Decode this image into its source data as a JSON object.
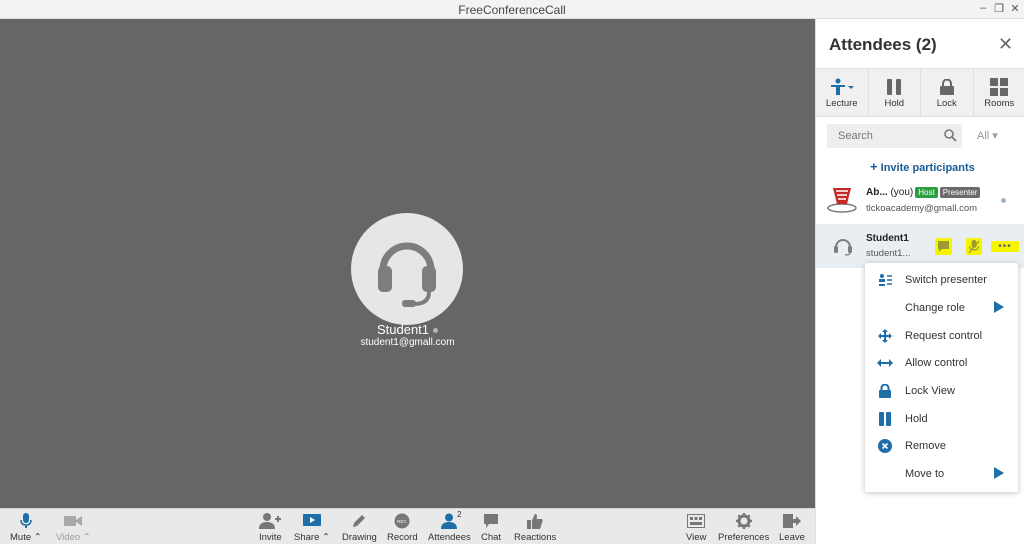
{
  "window": {
    "title": "FreeConferenceCall"
  },
  "stage": {
    "participant_name": "Student1",
    "participant_email": "student1@gmall.com"
  },
  "toolbar": {
    "mute": "Mute",
    "video": "Video",
    "invite": "Invite",
    "share": "Share",
    "drawing": "Drawing",
    "record": "Record",
    "attendees": "Attendees",
    "attendees_count": "2",
    "chat": "Chat",
    "reactions": "Reactions",
    "view": "View",
    "preferences": "Preferences",
    "leave": "Leave",
    "record_icon_text": "REC"
  },
  "panel": {
    "title": "Attendees (2)",
    "tools": {
      "lecture": "Lecture",
      "hold": "Hold",
      "lock": "Lock",
      "rooms": "Rooms"
    },
    "search_placeholder": "Search",
    "filter": "All",
    "invite_label": "Invite participants",
    "attendees": [
      {
        "name": "Ab...",
        "you": "(you)",
        "tag_host": "Host",
        "tag_presenter": "Presenter",
        "email": "tlckoacademy@gmall.com"
      },
      {
        "name": "Student1",
        "email": "student1..."
      }
    ]
  },
  "menu": {
    "items": [
      "Switch presenter",
      "Change role",
      "Request control",
      "Allow control",
      "Lock View",
      "Hold",
      "Remove",
      "Move to"
    ]
  },
  "colors": {
    "accent": "#1e6ea7",
    "host": "#2b9e3f",
    "presenter": "#6b6b6b",
    "highlight": "#f5f500"
  }
}
